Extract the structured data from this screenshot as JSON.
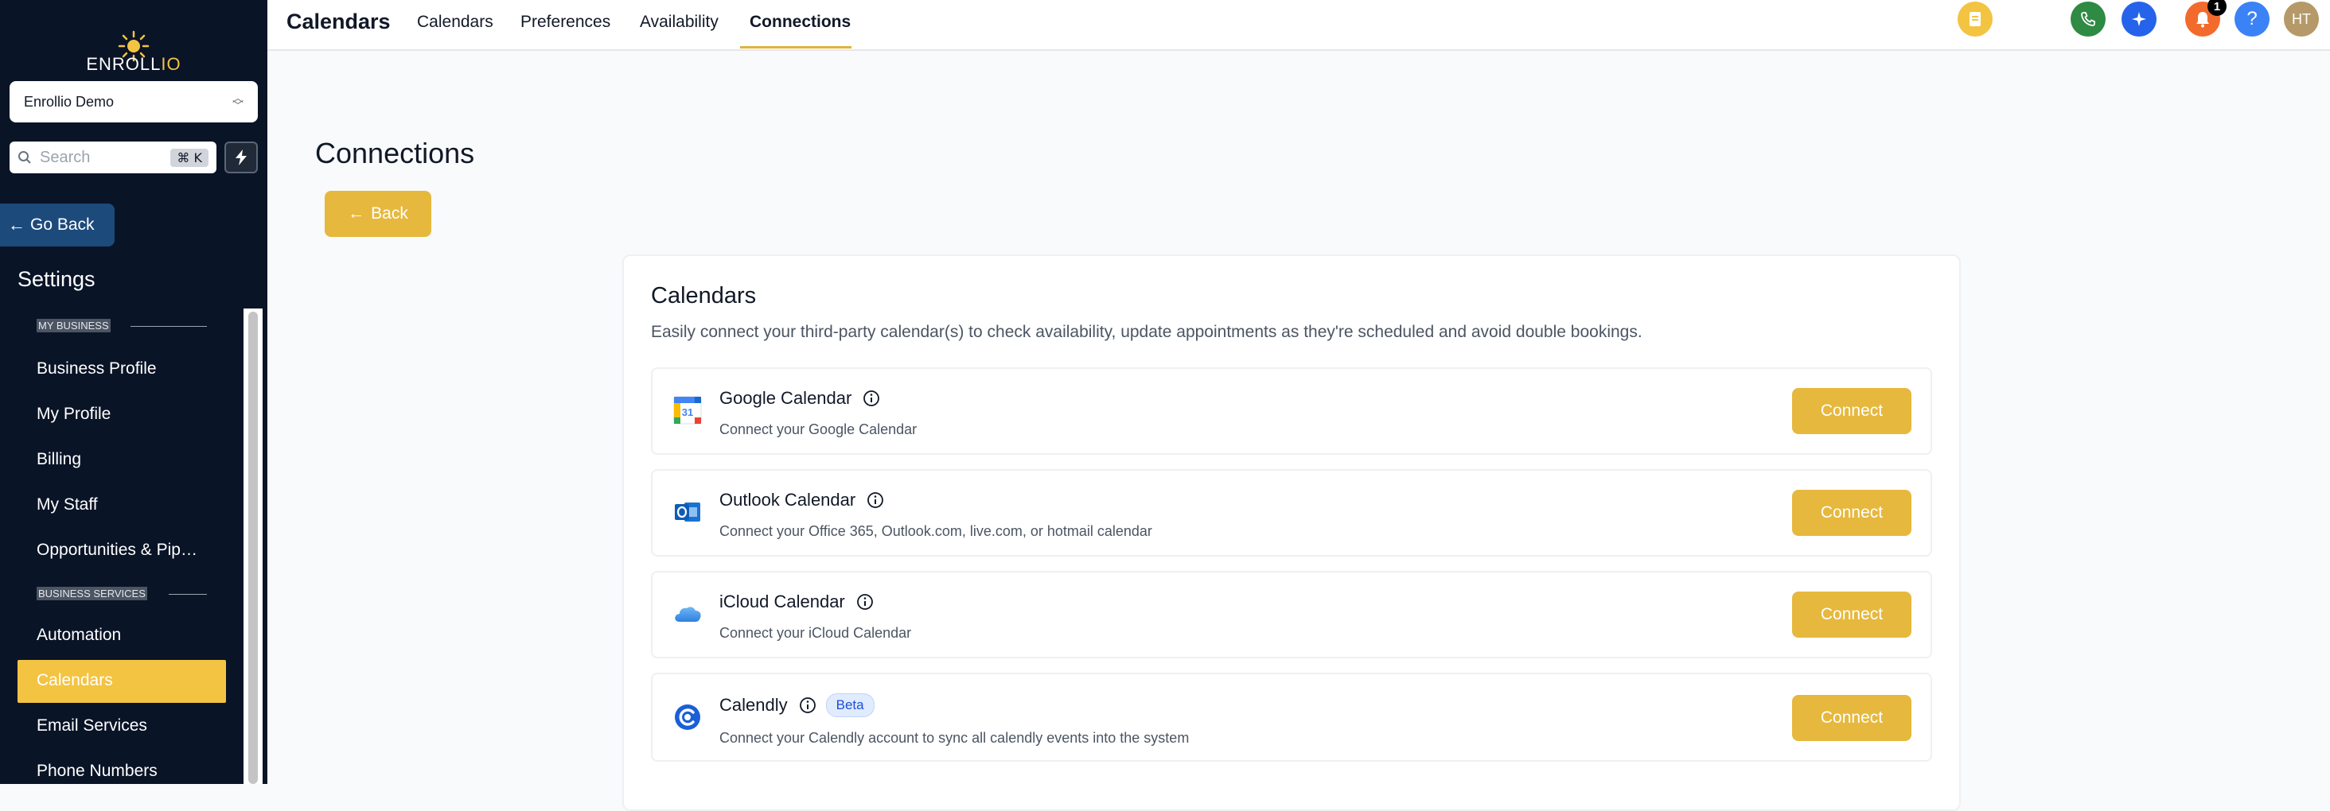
{
  "brand": {
    "logo_text_main": "ENROLL",
    "logo_text_accent": "IO",
    "accent_color": "#f3c442"
  },
  "sidebar": {
    "location": "Enrollio Demo",
    "search_placeholder": "Search",
    "search_shortcut": "⌘ K",
    "go_back_label": "Go Back",
    "settings_title": "Settings",
    "sections": [
      {
        "label": "MY BUSINESS",
        "items": [
          "Business Profile",
          "My Profile",
          "Billing",
          "My Staff",
          "Opportunities & Pipe…"
        ]
      },
      {
        "label": "BUSINESS SERVICES",
        "items": [
          "Automation",
          "Calendars",
          "Email Services",
          "Phone Numbers"
        ]
      }
    ],
    "active_item": "Calendars"
  },
  "topbar": {
    "title": "Calendars",
    "tabs": [
      "Calendars",
      "Preferences",
      "Availability",
      "Connections"
    ],
    "active_tab": "Connections",
    "notification_count": "1",
    "help_label": "?",
    "avatar_initials": "HT"
  },
  "main": {
    "heading": "Connections",
    "back_label": "Back"
  },
  "card": {
    "title": "Calendars",
    "description": "Easily connect your third-party calendar(s) to check availability, update appointments as they're scheduled and avoid double bookings.",
    "providers": [
      {
        "name": "Google Calendar",
        "subtitle": "Connect your Google Calendar",
        "button": "Connect",
        "icon": "google-calendar-icon"
      },
      {
        "name": "Outlook Calendar",
        "subtitle": "Connect your Office 365, Outlook.com, live.com, or hotmail calendar",
        "button": "Connect",
        "icon": "outlook-icon"
      },
      {
        "name": "iCloud Calendar",
        "subtitle": "Connect your iCloud Calendar",
        "button": "Connect",
        "icon": "icloud-icon"
      },
      {
        "name": "Calendly",
        "badge": "Beta",
        "subtitle": "Connect your Calendly account to sync all calendly events into the system",
        "button": "Connect",
        "icon": "calendly-icon"
      }
    ]
  }
}
